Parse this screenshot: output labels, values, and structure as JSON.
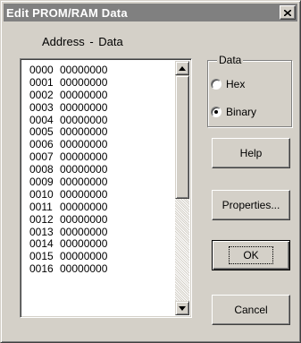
{
  "window": {
    "title": "Edit PROM/RAM Data"
  },
  "header": {
    "address_label": "Address",
    "separator": "-",
    "data_label": "Data"
  },
  "rows": [
    {
      "address": "0000",
      "value": "00000000"
    },
    {
      "address": "0001",
      "value": "00000000"
    },
    {
      "address": "0002",
      "value": "00000000"
    },
    {
      "address": "0003",
      "value": "00000000"
    },
    {
      "address": "0004",
      "value": "00000000"
    },
    {
      "address": "0005",
      "value": "00000000"
    },
    {
      "address": "0006",
      "value": "00000000"
    },
    {
      "address": "0007",
      "value": "00000000"
    },
    {
      "address": "0008",
      "value": "00000000"
    },
    {
      "address": "0009",
      "value": "00000000"
    },
    {
      "address": "0010",
      "value": "00000000"
    },
    {
      "address": "0011",
      "value": "00000000"
    },
    {
      "address": "0012",
      "value": "00000000"
    },
    {
      "address": "0013",
      "value": "00000000"
    },
    {
      "address": "0014",
      "value": "00000000"
    },
    {
      "address": "0015",
      "value": "00000000"
    },
    {
      "address": "0016",
      "value": "00000000"
    }
  ],
  "data_group": {
    "label": "Data",
    "options": [
      {
        "label": "Hex",
        "checked": false
      },
      {
        "label": "Binary",
        "checked": true
      }
    ]
  },
  "buttons": {
    "help": "Help",
    "properties": "Properties...",
    "ok": "OK",
    "cancel": "Cancel"
  },
  "icons": {
    "close": "close-icon",
    "scroll_up": "arrow-up-icon",
    "scroll_down": "arrow-down-icon"
  },
  "colors": {
    "titlebar": "#808080",
    "face": "#d4d0c8",
    "list_bg": "#ffffff"
  }
}
